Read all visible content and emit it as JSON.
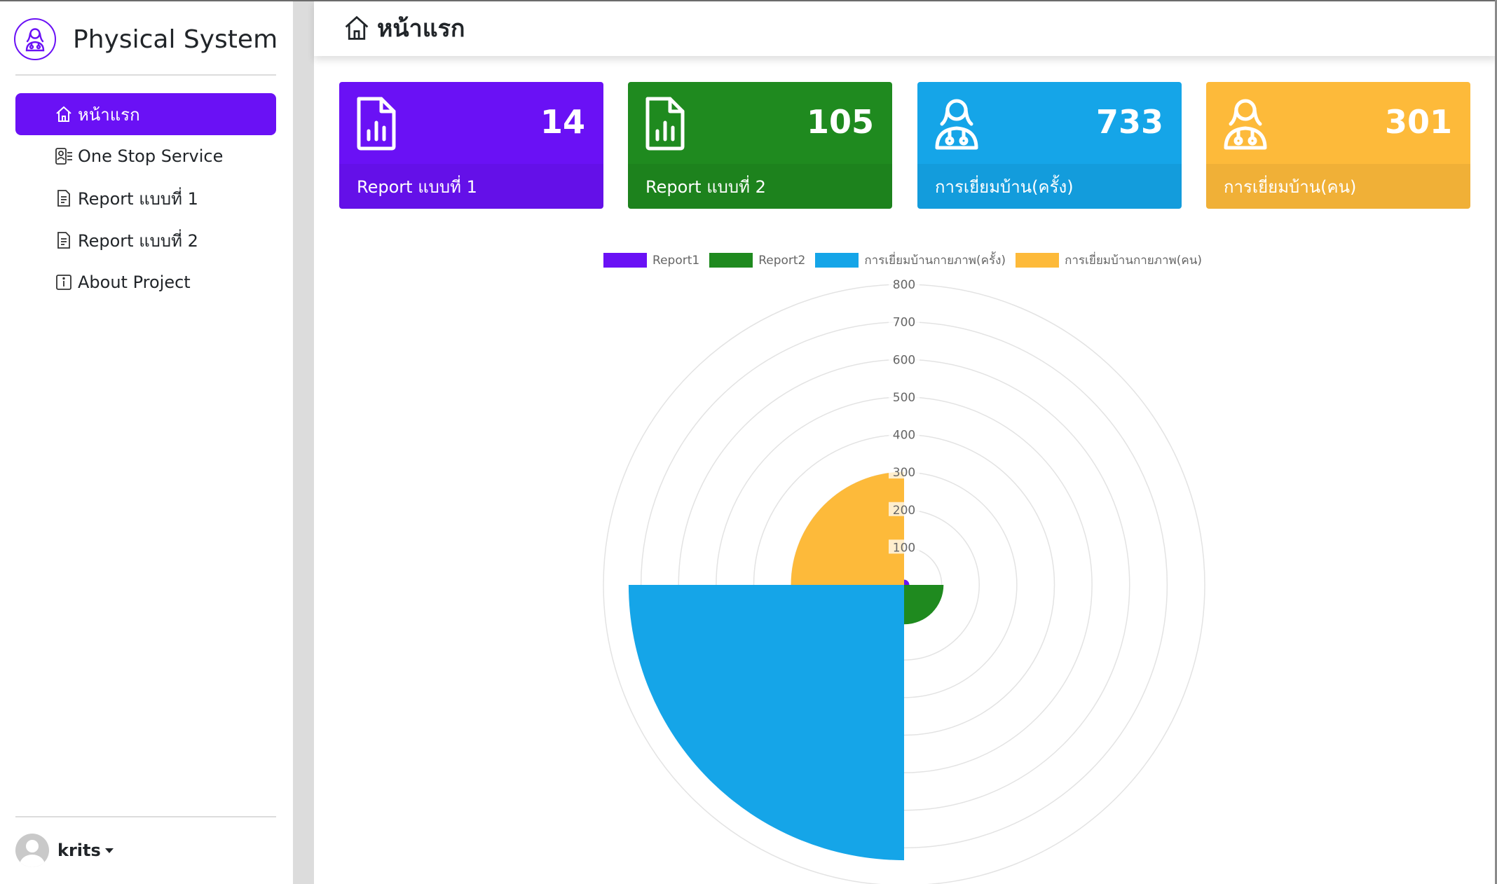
{
  "sidebar": {
    "brand_title": "Physical System",
    "nav": [
      {
        "label": "หน้าแรก",
        "icon": "home-icon",
        "active": true
      },
      {
        "label": "One Stop Service",
        "icon": "person-lines-icon",
        "active": false
      },
      {
        "label": "Report แบบที่ 1",
        "icon": "file-text-icon",
        "active": false
      },
      {
        "label": "Report แบบที่ 2",
        "icon": "file-text-icon",
        "active": false
      },
      {
        "label": "About Project",
        "icon": "info-square-icon",
        "active": false
      }
    ],
    "user": {
      "name": "krits"
    }
  },
  "header": {
    "title": "หน้าแรก",
    "icon": "home-icon"
  },
  "cards": [
    {
      "value": "14",
      "label": "Report แบบที่ 1",
      "color": "#6a11f5",
      "icon": "file-bar-chart-icon"
    },
    {
      "value": "105",
      "label": "Report แบบที่ 2",
      "color": "#1f8a1f",
      "icon": "file-bar-chart-icon"
    },
    {
      "value": "733",
      "label": "การเยี่ยมบ้าน(ครั้ง)",
      "color": "#15a5e8",
      "icon": "doctor-icon"
    },
    {
      "value": "301",
      "label": "การเยี่ยมบ้าน(คน)",
      "color": "#fdba3a",
      "icon": "doctor-icon"
    }
  ],
  "chart_data": {
    "type": "polarArea",
    "series": [
      {
        "name": "Report1",
        "value": 14,
        "color": "#6a11f5"
      },
      {
        "name": "Report2",
        "value": 105,
        "color": "#1f8a1f"
      },
      {
        "name": "การเยี่ยมบ้านกายภาพ(ครั้ง)",
        "value": 733,
        "color": "#15a5e8"
      },
      {
        "name": "การเยี่ยมบ้านกายภาพ(คน)",
        "value": 301,
        "color": "#fdba3a"
      }
    ],
    "r_ticks": [
      "100",
      "200",
      "300",
      "400",
      "500",
      "600",
      "700",
      "800"
    ],
    "r_max": 800,
    "legend_position": "top"
  }
}
